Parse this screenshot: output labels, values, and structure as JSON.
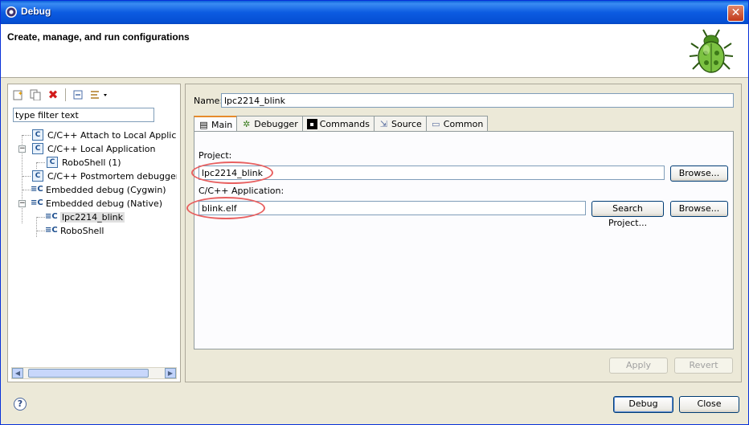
{
  "window": {
    "title": "Debug",
    "close_glyph": "✕"
  },
  "header": {
    "title": "Create, manage, and run configurations",
    "icon": "bug-icon"
  },
  "left": {
    "filter_value": "type filter text",
    "toolbar": [
      "new-config-icon",
      "duplicate-icon",
      "delete-icon",
      "collapse-all-icon",
      "filter-icon"
    ],
    "tree": [
      {
        "label": "C/C++ Attach to Local Applicat",
        "icon": "C"
      },
      {
        "label": "C/C++ Local Application",
        "icon": "C",
        "expanded": true
      },
      {
        "label": "RoboShell (1)",
        "icon": "C"
      },
      {
        "label": "C/C++ Postmortem debugger",
        "icon": "C"
      },
      {
        "label": "Embedded debug (Cygwin)",
        "icon": "=C"
      },
      {
        "label": "Embedded debug (Native)",
        "icon": "=C",
        "expanded": true
      },
      {
        "label": "lpc2214_blink",
        "icon": "=C",
        "selected": true
      },
      {
        "label": "RoboShell",
        "icon": "=C"
      }
    ]
  },
  "right": {
    "name_label": "Name:",
    "name_value": "lpc2214_blink",
    "tabs": [
      {
        "label": "Main",
        "icon": "main-tab-icon",
        "glyph": "▤"
      },
      {
        "label": "Debugger",
        "icon": "debugger-tab-icon",
        "glyph": "✲"
      },
      {
        "label": "Commands",
        "icon": "commands-tab-icon",
        "glyph": "▪"
      },
      {
        "label": "Source",
        "icon": "source-tab-icon",
        "glyph": "⇲"
      },
      {
        "label": "Common",
        "icon": "common-tab-icon",
        "glyph": "▭"
      }
    ],
    "project_label": "Project:",
    "project_value": "lpc2214_blink",
    "browse_label": "Browse...",
    "app_label": "C/C++ Application:",
    "app_value": "blink.elf",
    "search_label": "Search Project...",
    "browse2_label": "Browse...",
    "apply_label": "Apply",
    "revert_label": "Revert"
  },
  "footer": {
    "help_glyph": "?",
    "debug_label": "Debug",
    "close_label": "Close"
  },
  "colors": {
    "titlebar": "#0c5be1",
    "annotation": "#e86060",
    "active_tab": "#e68b2c"
  }
}
